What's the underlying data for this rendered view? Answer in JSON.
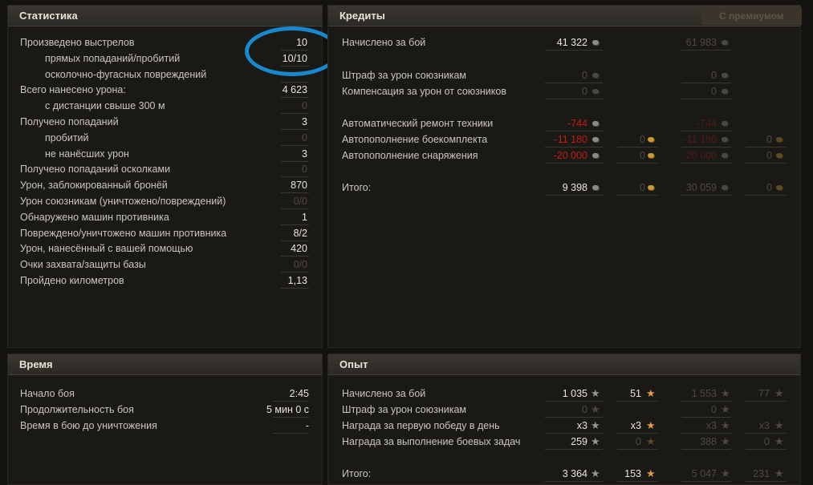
{
  "stats": {
    "title": "Статистика",
    "rows": [
      {
        "label": "Произведено выстрелов",
        "value": "10",
        "indent": false,
        "dim": false
      },
      {
        "label": "прямых попаданий/пробитий",
        "value": "10/10",
        "indent": true,
        "dim": false
      },
      {
        "label": "осколочно-фугасных повреждений",
        "value": "",
        "indent": true,
        "dim": false
      },
      {
        "label": "Всего нанесено урона:",
        "value": "4 623",
        "indent": false,
        "dim": false
      },
      {
        "label": "с дистанции свыше 300 м",
        "value": "0",
        "indent": true,
        "dim": true
      },
      {
        "label": "Получено попаданий",
        "value": "3",
        "indent": false,
        "dim": false
      },
      {
        "label": "пробитий",
        "value": "0",
        "indent": true,
        "dim": true
      },
      {
        "label": "не нанёсших урон",
        "value": "3",
        "indent": true,
        "dim": false
      },
      {
        "label": "Получено попаданий осколками",
        "value": "0",
        "indent": false,
        "dim": true
      },
      {
        "label": "Урон, заблокированный бронёй",
        "value": "870",
        "indent": false,
        "dim": false
      },
      {
        "label": "Урон союзникам (уничтожено/повреждений)",
        "value": "0/0",
        "indent": false,
        "dim": true
      },
      {
        "label": "Обнаружено машин противника",
        "value": "1",
        "indent": false,
        "dim": false
      },
      {
        "label": "Повреждено/уничтожено машин противника",
        "value": "8/2",
        "indent": false,
        "dim": false
      },
      {
        "label": "Урон, нанесённый с вашей помощью",
        "value": "420",
        "indent": false,
        "dim": false
      },
      {
        "label": "Очки захвата/защиты базы",
        "value": "0/0",
        "indent": false,
        "dim": true
      },
      {
        "label": "Пройдено километров",
        "value": "1,13",
        "indent": false,
        "dim": false
      }
    ]
  },
  "credits": {
    "title": "Кредиты",
    "premium_title": "С премиумом",
    "rows": [
      {
        "label": "Начислено за бой",
        "base": "41 322",
        "base_style": "normal",
        "base_gold": "",
        "prem": "61 983",
        "prem_gold": ""
      },
      {
        "label": "Штраф за урон союзникам",
        "base": "0",
        "base_style": "dim",
        "base_gold": "",
        "prem": "0",
        "prem_gold": ""
      },
      {
        "label": "Компенсация за урон от союзников",
        "base": "0",
        "base_style": "dim",
        "base_gold": "",
        "prem": "0",
        "prem_gold": ""
      },
      {
        "label": "Автоматический ремонт техники",
        "base": "-744",
        "base_style": "red",
        "base_gold": "",
        "prem": "-744",
        "prem_gold": ""
      },
      {
        "label": "Автопополнение боекомплекта",
        "base": "-11 180",
        "base_style": "red",
        "base_gold": "0",
        "prem": "-11 180",
        "prem_gold": "0"
      },
      {
        "label": "Автопополнение снаряжения",
        "base": "-20 000",
        "base_style": "red",
        "base_gold": "0",
        "prem": "-20 000",
        "prem_gold": "0"
      },
      {
        "label": "Итого:",
        "base": "9 398",
        "base_style": "normal",
        "base_gold": "0",
        "prem": "30 059",
        "prem_gold": "0"
      }
    ]
  },
  "time": {
    "title": "Время",
    "rows": [
      {
        "label": "Начало боя",
        "value": "2:45"
      },
      {
        "label": "Продолжительность боя",
        "value": "5 мин 0 с"
      },
      {
        "label": "Время в бою до уничтожения",
        "value": "-"
      }
    ]
  },
  "exp": {
    "title": "Опыт",
    "rows": [
      {
        "label": "Начислено за бой",
        "base": "1 035",
        "base_dim": false,
        "free": "51",
        "free_dim": false,
        "prem": "1 553",
        "prem_free": "77"
      },
      {
        "label": "Штраф за урон союзникам",
        "base": "0",
        "base_dim": true,
        "free": "",
        "free_dim": true,
        "prem": "0",
        "prem_free": ""
      },
      {
        "label": "Награда за первую победу в день",
        "base": "x3",
        "base_dim": false,
        "free": "x3",
        "free_dim": false,
        "prem": "x3",
        "prem_free": "x3"
      },
      {
        "label": "Награда за выполнение боевых задач",
        "base": "259",
        "base_dim": false,
        "free": "0",
        "free_dim": true,
        "prem": "388",
        "prem_free": "0"
      },
      {
        "label": "Итого:",
        "base": "3 364",
        "base_dim": false,
        "free": "153",
        "free_dim": false,
        "prem": "5 047",
        "prem_free": "231"
      }
    ]
  }
}
